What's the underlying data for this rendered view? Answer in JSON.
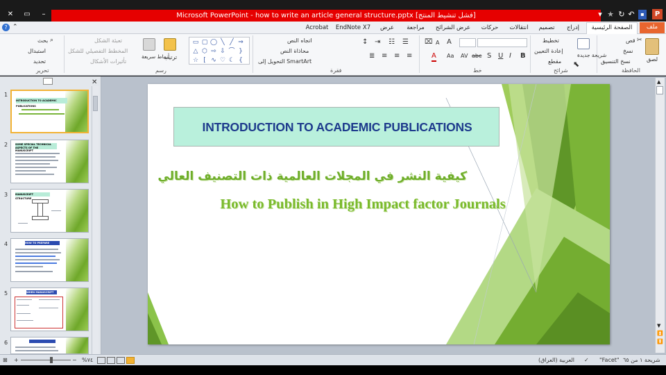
{
  "window": {
    "title": "Microsoft PowerPoint - how to write an article general structure.pptx [فشل تنشيط المنتج]",
    "accent_color": "#e60000"
  },
  "quick_access": {
    "app_icon": "powerpoint-p-icon",
    "save_icon": "save-icon",
    "undo_icon": "undo-icon",
    "redo_icon": "repeat-icon",
    "star_icon": "star-icon",
    "customize_icon": "dropdown-icon"
  },
  "window_controls": {
    "close": "✕",
    "maximize": "▭",
    "minimize": "–"
  },
  "ribbon_tabs": [
    {
      "label": "ملف",
      "kind": "file"
    },
    {
      "label": "الصفحة الرئيسية",
      "kind": "active"
    },
    {
      "label": "إدراج",
      "kind": "normal"
    },
    {
      "label": "تصميم",
      "kind": "normal"
    },
    {
      "label": "انتقالات",
      "kind": "normal"
    },
    {
      "label": "حركات",
      "kind": "normal"
    },
    {
      "label": "عرض الشرائح",
      "kind": "normal"
    },
    {
      "label": "مراجعة",
      "kind": "normal"
    },
    {
      "label": "عرض",
      "kind": "normal"
    },
    {
      "label": "EndNote X7",
      "kind": "normal"
    },
    {
      "label": "Acrobat",
      "kind": "normal"
    }
  ],
  "ribbon": {
    "clipboard": {
      "label": "الحافظة",
      "paste": "لصق",
      "cut": "قص",
      "copy": "نسخ",
      "format_painter": "نسخ التنسيق"
    },
    "slides": {
      "label": "شرائح",
      "new_slide": "شريحة جديدة",
      "layout": "تخطيط",
      "reset": "إعادة التعيين",
      "section": "مقطع"
    },
    "font": {
      "label": "خط",
      "buttons": [
        "B",
        "I",
        "U",
        "S",
        "abc",
        "AV",
        "Aa",
        "A"
      ]
    },
    "paragraph": {
      "label": "فقرة",
      "text_direction": "اتجاه النص",
      "align_text": "محاذاة النص",
      "convert_smartart": "التحويل إلى SmartArt"
    },
    "drawing": {
      "label": "رسم",
      "arrange": "ترتيب",
      "quick_styles": "أنماط سريعة",
      "shape_fill": "تعبئة الشكل",
      "shape_outline": "المخطط التفصيلي للشكل",
      "shape_effects": "تأثيرات الأشكال"
    },
    "editing": {
      "label": "تحرير",
      "find": "بحث",
      "replace": "استبدال",
      "select": "تحديد"
    }
  },
  "slides_pane": {
    "thumbnails": [
      {
        "number": "1",
        "title": "INTRODUCTION TO ACADEMIC PUBLICATIONS",
        "selected": true
      },
      {
        "number": "2",
        "title": "SOME SPECIAL TECHNICAL ASPECTS OF THE MANUSCRIPT",
        "selected": false
      },
      {
        "number": "3",
        "title": "MANUSCRIPT STRUCTURE",
        "selected": false
      },
      {
        "number": "4",
        "title": "HOW TO PREPARE MANUSCRIPT",
        "selected": false
      },
      {
        "number": "5",
        "title": "WHEN MANUSCRIPT",
        "selected": false
      },
      {
        "number": "6",
        "title": "",
        "selected": false
      }
    ]
  },
  "slide": {
    "title": "INTRODUCTION TO ACADEMIC PUBLICATIONS",
    "subtitle_arabic": "كيفية النشر في المجلات العالمية ذات التصنيف العالي",
    "subtitle_english": "How to Publish in High Impact factor Journals",
    "title_color": "#1d3a8c",
    "title_fill": "#b9f0dc",
    "subtitle_color": "#7aba2c"
  },
  "status_bar": {
    "slide_info": "شريحة ١ من ٦٥",
    "theme": "\"Facet\"",
    "language": "العربية (العراق)",
    "zoom": "%٧٤"
  }
}
